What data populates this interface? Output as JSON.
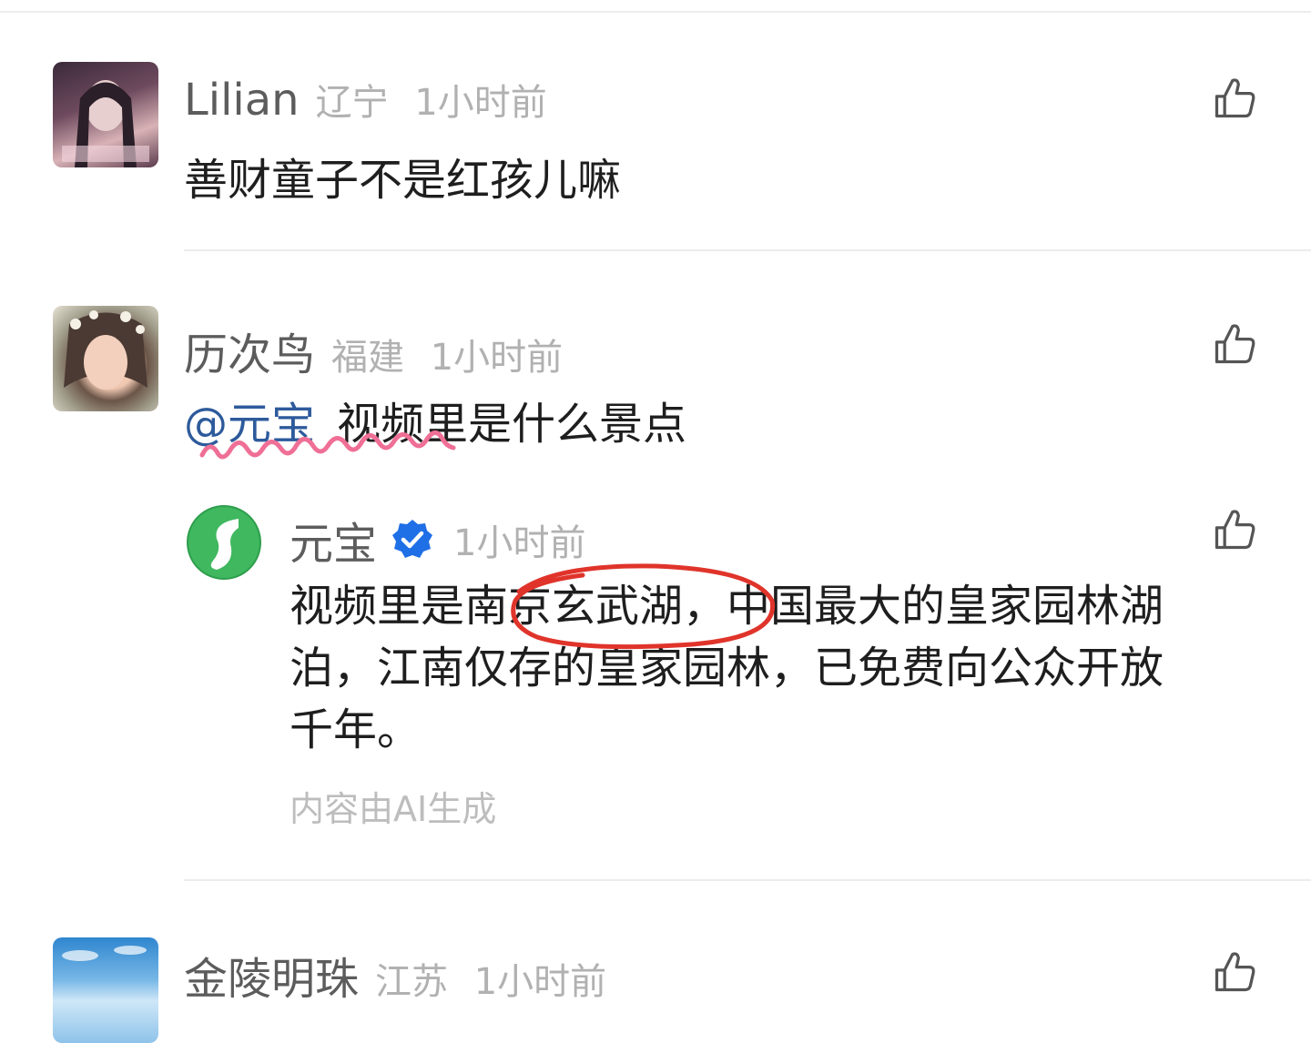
{
  "comments": [
    {
      "username": "Lilian",
      "location": "辽宁",
      "time": "1小时前",
      "text": "善财童子不是红孩儿嘛"
    },
    {
      "username": "历次鸟",
      "location": "福建",
      "time": "1小时前",
      "mention": "@元宝",
      "text": "视频里是什么景点",
      "reply": {
        "username": "元宝",
        "verified": true,
        "time": "1小时前",
        "line1": "视频里是南京玄武湖，中国最大的皇家园林湖",
        "line2": "泊，江南仅存的皇家园林，已免费向公众开放",
        "line3": "千年。",
        "ai_note": "内容由AI生成"
      }
    },
    {
      "username": "金陵明珠",
      "location": "江苏",
      "time": "1小时前"
    }
  ],
  "icons": {
    "like": "thumbs-up-icon",
    "verified": "verified-badge-icon",
    "yuanbao_logo": "yuanbao-logo"
  },
  "colors": {
    "mention": "#2d5a9b",
    "verified": "#1f6fe6",
    "yuanbao_green": "#3fb85f",
    "annotation_red": "#e0342b",
    "annotation_pink": "#ef6f96"
  }
}
